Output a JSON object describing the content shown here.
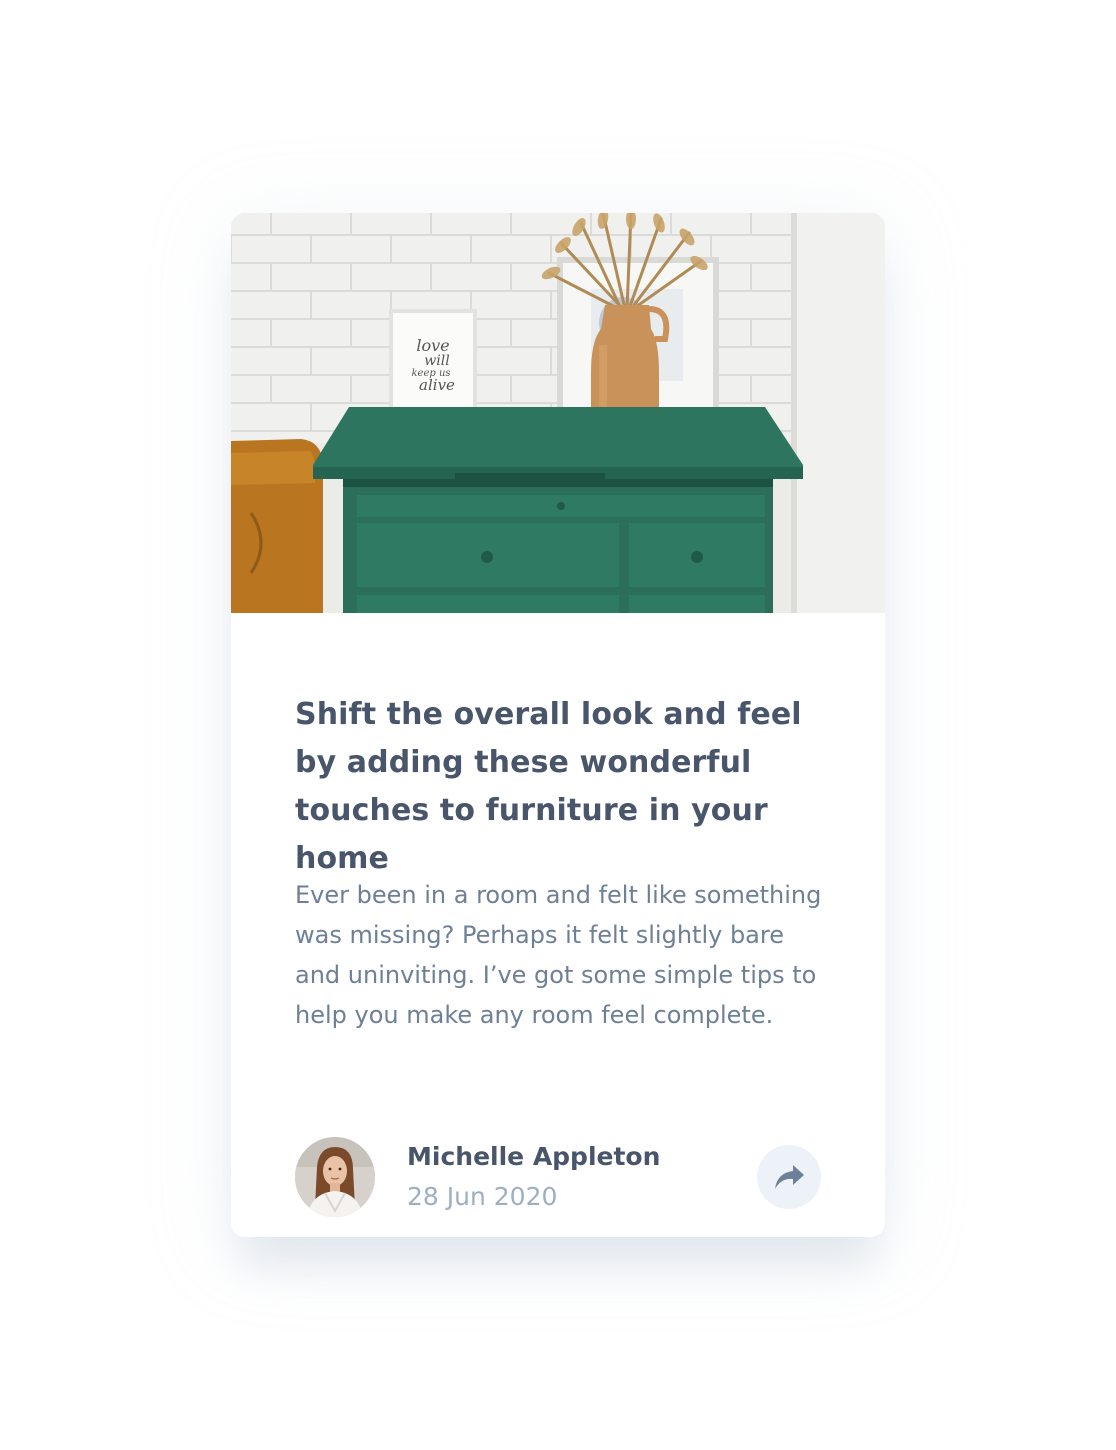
{
  "article": {
    "image_alt": "Green drawers with framed pictures and a vase of dried grass against a white brick wall",
    "frame_text": [
      "love",
      "will",
      "keep us",
      "alive"
    ],
    "title": "Shift the overall look and feel by adding these wonderful touches to furniture in your home",
    "excerpt": "Ever been in a room and felt like something was missing? Perhaps it felt slightly bare and uninviting. I’ve got some simple tips to help you make any room feel complete."
  },
  "author": {
    "name": "Michelle Appleton",
    "date": "28 Jun 2020"
  },
  "share": {
    "icon": "share-icon"
  },
  "colors": {
    "title": "#48556a",
    "body": "#6e8098",
    "date": "#9eafc2",
    "share_bg": "#ecf2f8",
    "share_icon": "#6e8098",
    "drawer_green": "#2b6e5a"
  }
}
